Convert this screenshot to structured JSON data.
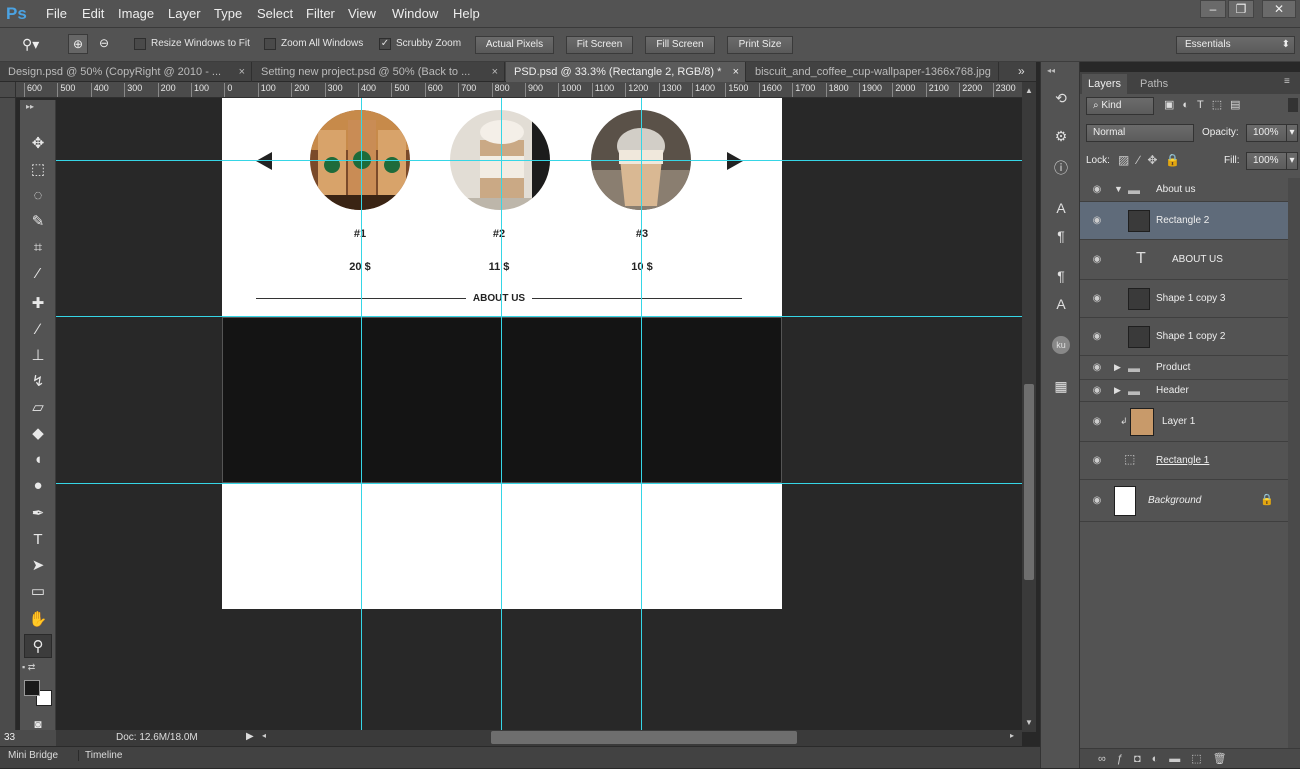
{
  "menu": [
    "File",
    "Edit",
    "Image",
    "Layer",
    "Type",
    "Select",
    "Filter",
    "View",
    "Window",
    "Help"
  ],
  "app_logo": "Ps",
  "window_controls": {
    "minimize": "–",
    "restore": "❐",
    "close": "✕"
  },
  "options": {
    "resize_windows_label": "Resize Windows to Fit",
    "resize_windows_checked": false,
    "zoom_all_label": "Zoom All Windows",
    "zoom_all_checked": false,
    "scrubby_zoom_label": "Scrubby Zoom",
    "scrubby_zoom_checked": true,
    "actual_pixels": "Actual Pixels",
    "fit_screen": "Fit Screen",
    "fill_screen": "Fill Screen",
    "print_size": "Print Size",
    "workspace": "Essentials"
  },
  "doc_tabs": [
    {
      "label": "Design.psd @ 50% (CopyRight @ 2010 - ...",
      "close": "×",
      "active": false
    },
    {
      "label": "Setting new project.psd @ 50% (Back to ...",
      "close": "×",
      "active": false
    },
    {
      "label": "PSD.psd @ 33.3% (Rectangle 2, RGB/8) *",
      "close": "×",
      "active": true
    },
    {
      "label": "biscuit_and_coffee_cup-wallpaper-1366x768.jpg",
      "close": "",
      "active": false
    }
  ],
  "tab_overflow": "»",
  "ruler_ticks": [
    "600",
    "500",
    "400",
    "300",
    "200",
    "100",
    "0",
    "100",
    "200",
    "300",
    "400",
    "500",
    "600",
    "700",
    "800",
    "900",
    "1000",
    "1100",
    "1200",
    "1300",
    "1400",
    "1500",
    "1600",
    "1700",
    "1800",
    "1900",
    "2000",
    "2100",
    "2200",
    "2300"
  ],
  "products": [
    {
      "num": "#1",
      "price": "20 $"
    },
    {
      "num": "#2",
      "price": "11 $"
    },
    {
      "num": "#3",
      "price": "10 $"
    }
  ],
  "about_heading": "ABOUT US",
  "status": {
    "zoom": "33",
    "doc": "Doc: 12.6M/18.0M"
  },
  "bottom_tabs": [
    "Mini Bridge",
    "Timeline"
  ],
  "panel": {
    "tabs": [
      "Layers",
      "Paths"
    ],
    "kind_label": "Kind",
    "blend_mode": "Normal",
    "opacity_label": "Opacity:",
    "opacity_value": "100%",
    "lock_label": "Lock:",
    "fill_label": "Fill:",
    "fill_value": "100%"
  },
  "layers": [
    {
      "name": "About us",
      "type": "group",
      "expanded": true,
      "selected": false
    },
    {
      "name": "Rectangle 2",
      "type": "shape",
      "selected": true
    },
    {
      "name": "ABOUT US",
      "type": "text",
      "selected": false
    },
    {
      "name": "Shape 1 copy 3",
      "type": "shape",
      "selected": false
    },
    {
      "name": "Shape 1 copy 2",
      "type": "shape",
      "selected": false
    },
    {
      "name": "Product",
      "type": "group",
      "expanded": false,
      "selected": false
    },
    {
      "name": "Header",
      "type": "group",
      "expanded": false,
      "selected": false
    },
    {
      "name": "Layer 1",
      "type": "image",
      "selected": false
    },
    {
      "name": "Rectangle 1",
      "type": "shape",
      "selected": false
    },
    {
      "name": "Background",
      "type": "background",
      "locked": true,
      "selected": false
    }
  ],
  "colors": {
    "accent_guide": "#36d6e6",
    "selected_row": "#5f6b7a",
    "logo": "#4ba3e3"
  }
}
